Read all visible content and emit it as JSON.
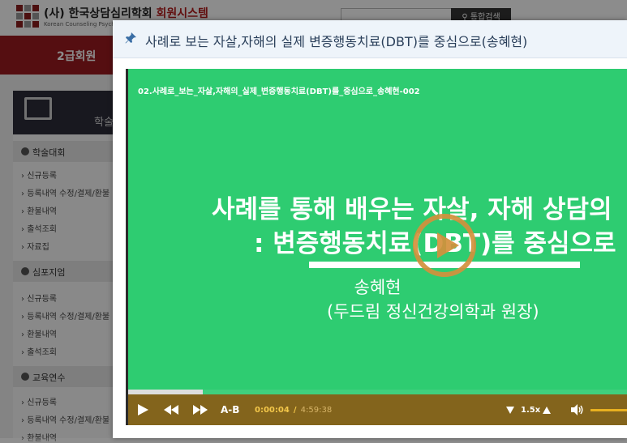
{
  "background": {
    "org_name": "(사) 한국상담심리학회",
    "system_name": "회원시스템",
    "org_sub": "Korean Counseling Psychological Association",
    "search_button": "통합검색",
    "nav_item": "2급회원",
    "sidebar_head": "학술",
    "sections": [
      {
        "title": "학술대회",
        "links": [
          "신규등록",
          "등록내역 수정/결제/환불",
          "환불내역",
          "출석조회",
          "자료집"
        ]
      },
      {
        "title": "심포지엄",
        "links": [
          "신규등록",
          "등록내역 수정/결제/환불",
          "환불내역",
          "출석조회"
        ]
      },
      {
        "title": "교육연수",
        "links": [
          "신규등록",
          "등록내역 수정/결제/환불",
          "환불내역"
        ]
      }
    ]
  },
  "modal": {
    "title": "사례로 보는 자살,자해의 실제 변증행동치료(DBT)를 중심으로(송혜현)",
    "pin_icon": "pin-icon"
  },
  "player": {
    "file_title": "02.사례로_보는_자살,자해의_실제_변증행동치료(DBT)를_중심으로_송혜현-002",
    "slide": {
      "line1": "사례를 통해 배우는 자살, 자해 상담의",
      "line2": ": 변증행동치료(DBT)를 중심으로",
      "name": "송혜현",
      "role": "(두드림 정신건강의학과 원장)"
    },
    "controls": {
      "ab_label": "A-B",
      "time_current": "0:00:04",
      "time_sep": "/",
      "time_total": "4:59:38",
      "speed": "1.5x"
    },
    "progress_fraction": 0.15,
    "colors": {
      "video_bg": "#2ecc71",
      "control_bar": "#83641c",
      "play_ring": "#d4903c",
      "time_color": "#f4c84a"
    }
  }
}
